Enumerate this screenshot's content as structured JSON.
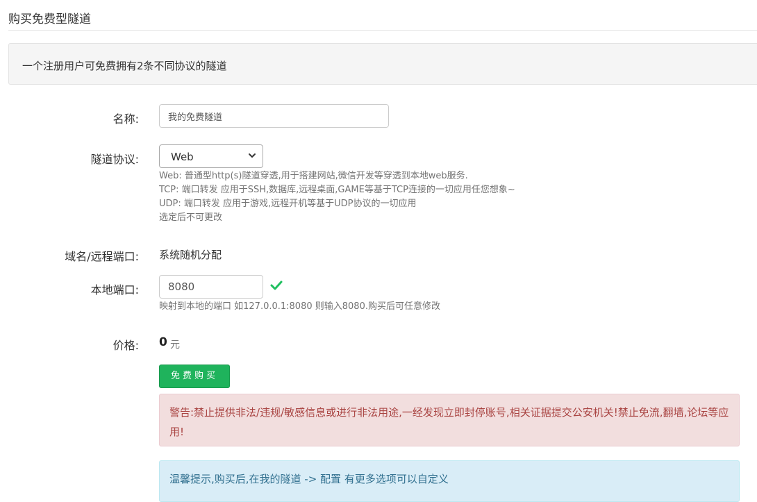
{
  "page": {
    "title": "购买免费型隧道",
    "info": "一个注册用户可免费拥有2条不同协议的隧道"
  },
  "form": {
    "name_label": "名称:",
    "name_value": "我的免费隧道",
    "protocol_label": "隧道协议:",
    "protocol_value": "Web",
    "protocol_help": [
      "Web: 普通型http(s)隧道穿透,用于搭建网站,微信开发等穿透到本地web服务.",
      "TCP: 端口转发 应用于SSH,数据库,远程桌面,GAME等基于TCP连接的一切应用任您想象~",
      "UDP: 端口转发 应用于游戏,远程开机等基于UDP协议的一切应用",
      "选定后不可更改"
    ],
    "domain_label": "域名/远程端口:",
    "domain_value": "系统随机分配",
    "port_label": "本地端口:",
    "port_value": "8080",
    "port_help": "映射到本地的端口 如127.0.0.1:8080 则输入8080.购买后可任意修改",
    "price_label": "价格:",
    "price_value": "0",
    "price_unit": "元",
    "buy_button": "免费购买"
  },
  "alerts": {
    "warning": "警告:禁止提供非法/违规/敏感信息或进行非法用途,一经发现立即封停账号,相关证据提交公安机关!禁止免流,翻墙,论坛等应用!",
    "tip": "温馨提示,购买后,在我的隧道 -> 配置 有更多选项可以自定义"
  },
  "icons": {
    "select_chevron": "chevron-down-icon",
    "port_valid": "check-icon"
  },
  "colors": {
    "success": "#1fb35c",
    "check": "#20c060",
    "danger_text": "#a94442",
    "info_text": "#31708f"
  }
}
